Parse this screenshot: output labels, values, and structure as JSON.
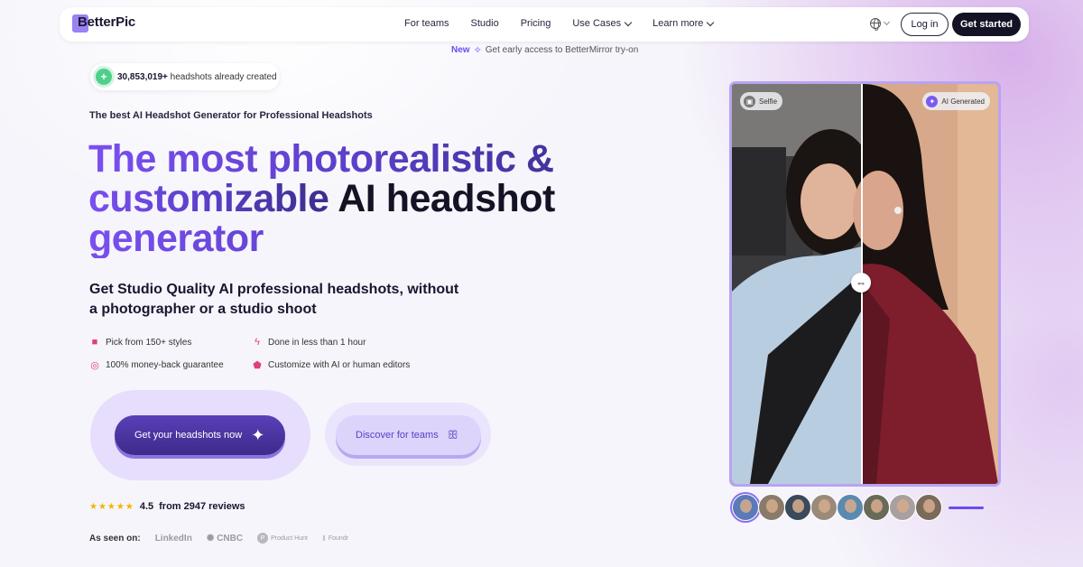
{
  "nav": {
    "logo": "BetterPic",
    "links": [
      {
        "label": "For teams",
        "dropdown": false
      },
      {
        "label": "Studio",
        "dropdown": false
      },
      {
        "label": "Pricing",
        "dropdown": false
      },
      {
        "label": "Use Cases",
        "dropdown": true
      },
      {
        "label": "Learn more",
        "dropdown": true
      }
    ],
    "login": "Log in",
    "get_started": "Get started",
    "language_icon": "globe-icon"
  },
  "announcement": {
    "badge": "New",
    "text": "Get early access to BetterMirror try-on"
  },
  "counter": {
    "count": "30,853,019+",
    "text": "headshots already created"
  },
  "hero": {
    "tagline": "The best AI Headshot Generator for Professional Headshots",
    "headline_line1": "The most photorealistic &",
    "headline_line2a": "customizable",
    "headline_line2b": " AI headshot",
    "headline_line3": "generator",
    "subheadline": "Get Studio Quality AI professional headshots, without a photographer or a studio shoot"
  },
  "features": [
    "Pick from 150+ styles",
    "Done in less than 1 hour",
    "100% money-back guarantee",
    "Customize with AI or human editors"
  ],
  "cta": {
    "primary": "Get your headshots now",
    "secondary": "Discover for teams"
  },
  "rating": {
    "stars": "★★★★★",
    "value": "4.5",
    "text": "from 2947 reviews"
  },
  "as_seen_on": {
    "label": "As seen on:",
    "brands": [
      "LinkedIn",
      "CNBC",
      "Product Hunt",
      "Foundr"
    ]
  },
  "compare": {
    "left_label": "Selfie",
    "right_label": "AI Generated",
    "slider_position": 0.48
  },
  "carousel": {
    "thumb_count": 8,
    "active_index": 0,
    "progress": 0.7
  },
  "colors": {
    "accent": "#6a4df0",
    "dark": "#141225",
    "star": "#f5b400"
  }
}
